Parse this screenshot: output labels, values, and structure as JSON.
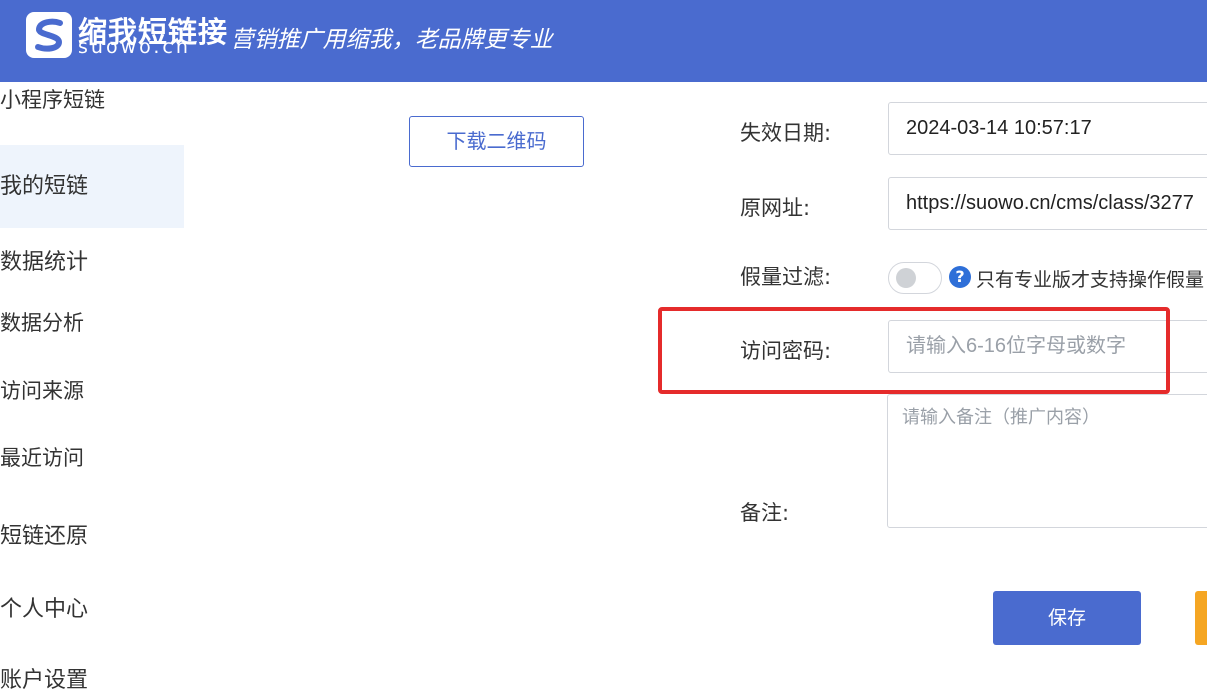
{
  "header": {
    "logo_cn": "缩我短链接",
    "logo_en": "suowo.cn",
    "slogan": "· 营销推广用缩我，老品牌更专业",
    "brand_color": "#4a6bcf"
  },
  "sidebar": {
    "items": [
      {
        "label": "小程序短链"
      },
      {
        "label": "我的短链"
      },
      {
        "label": "数据统计"
      },
      {
        "label": "数据分析"
      },
      {
        "label": "访问来源"
      },
      {
        "label": "最近访问"
      },
      {
        "label": "短链还原"
      },
      {
        "label": "个人中心"
      },
      {
        "label": "账户设置"
      }
    ],
    "active_index": 1,
    "active_bg": "#eef4fc"
  },
  "qr": {
    "button_label": "下载二维码"
  },
  "form": {
    "expiry_label": "失效日期:",
    "expiry_value": "2024-03-14 10:57:17",
    "url_label": "原网址:",
    "url_value": "https://suowo.cn/cms/class/3277",
    "filter_label": "假量过滤:",
    "filter_enabled": false,
    "filter_help_icon": "question-circle-icon",
    "filter_help_text": "只有专业版才支持操作假量",
    "password_label": "访问密码:",
    "password_placeholder": "请输入6-16位字母或数字",
    "remark_label": "备注:",
    "remark_placeholder": "请输入备注（推广内容）",
    "save_label": "保存",
    "highlight_color": "#e52b2b",
    "secondary_button_color": "#f5a623"
  }
}
